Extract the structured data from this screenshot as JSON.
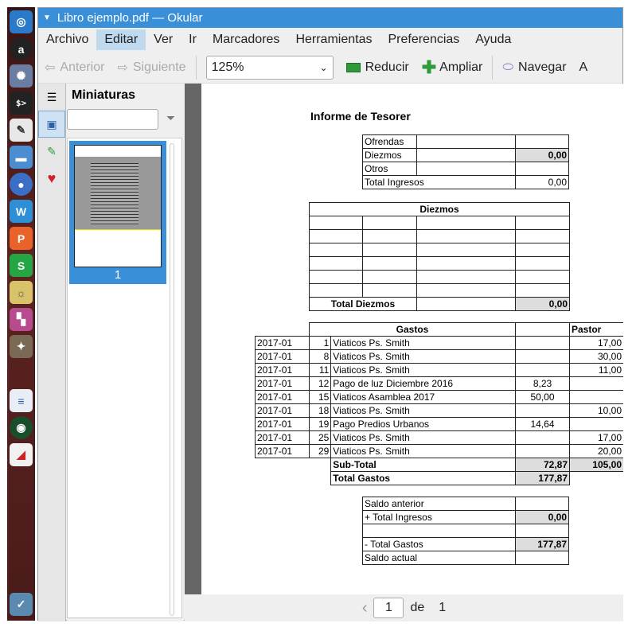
{
  "window": {
    "title": "Libro ejemplo.pdf — Okular"
  },
  "menubar": {
    "items": [
      "Archivo",
      "Editar",
      "Ver",
      "Ir",
      "Marcadores",
      "Herramientas",
      "Preferencias",
      "Ayuda"
    ],
    "active": "Editar"
  },
  "toolbar": {
    "prev_label": "Anterior",
    "next_label": "Siguiente",
    "zoom_value": "125%",
    "reduce_label": "Reducir",
    "enlarge_label": "Ampliar",
    "browse_label": "Navegar",
    "overflow_label": "A"
  },
  "sidebar": {
    "title": "Miniaturas",
    "search_placeholder": "",
    "thumb_page": "1"
  },
  "pager": {
    "current": "1",
    "of_label": "de",
    "total": "1"
  },
  "document": {
    "title": "Informe de Tesorer",
    "ingresos": [
      {
        "label": "Ofrendas",
        "value": ""
      },
      {
        "label": "Diezmos",
        "value": "0,00"
      },
      {
        "label": "Otros",
        "value": ""
      },
      {
        "label": "Total Ingresos",
        "value": "0,00"
      }
    ],
    "diezmos_header": "Diezmos",
    "diezmos_total_label": "Total Diezmos",
    "diezmos_total_value": "0,00",
    "gastos_header": "Gastos",
    "pastor_header": "Pastor",
    "gastos": [
      {
        "period": "2017-01",
        "day": "1",
        "desc": "Viaticos Ps. Smith",
        "amount": "",
        "pastor": "17,00"
      },
      {
        "period": "2017-01",
        "day": "8",
        "desc": "Viaticos Ps. Smith",
        "amount": "",
        "pastor": "30,00"
      },
      {
        "period": "2017-01",
        "day": "11",
        "desc": "Viaticos Ps. Smith",
        "amount": "",
        "pastor": "11,00"
      },
      {
        "period": "2017-01",
        "day": "12",
        "desc": "Pago de luz Diciembre 2016",
        "amount": "8,23",
        "pastor": ""
      },
      {
        "period": "2017-01",
        "day": "15",
        "desc": "Viaticos Asamblea 2017",
        "amount": "50,00",
        "pastor": ""
      },
      {
        "period": "2017-01",
        "day": "18",
        "desc": "Viaticos Ps. Smith",
        "amount": "",
        "pastor": "10,00"
      },
      {
        "period": "2017-01",
        "day": "19",
        "desc": "Pago Predios Urbanos",
        "amount": "14,64",
        "pastor": ""
      },
      {
        "period": "2017-01",
        "day": "25",
        "desc": "Viaticos Ps. Smith",
        "amount": "",
        "pastor": "17,00"
      },
      {
        "period": "2017-01",
        "day": "29",
        "desc": "Viaticos Ps. Smith",
        "amount": "",
        "pastor": "20,00"
      }
    ],
    "subtotal_label": "Sub-Total",
    "subtotal_amount": "72,87",
    "subtotal_pastor": "105,00",
    "total_gastos_label": "Total Gastos",
    "total_gastos_value": "177,87",
    "saldo": [
      {
        "label": "Saldo anterior",
        "value": ""
      },
      {
        "label": "+ Total Ingresos",
        "value": "0,00"
      },
      {
        "label": "",
        "value": ""
      },
      {
        "label": "- Total Gastos",
        "value": "177,87"
      },
      {
        "label": "Saldo actual",
        "value": ""
      }
    ]
  },
  "colors": {
    "accent": "#3a8fd9",
    "menu_active": "#bfd9ef",
    "dock": "#5c2321"
  }
}
